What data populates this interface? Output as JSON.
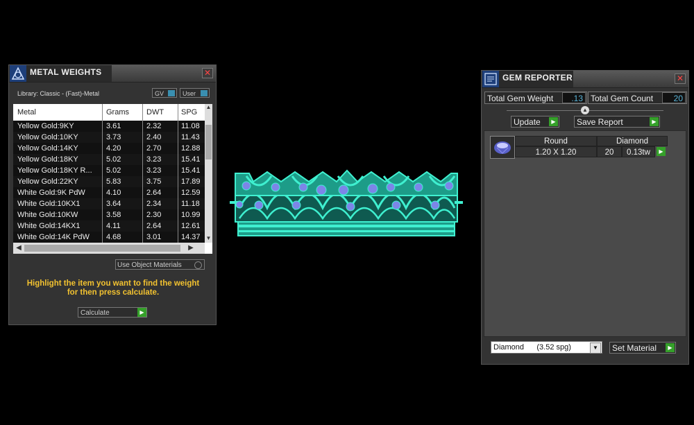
{
  "metal_weights": {
    "title": "METAL WEIGHTS",
    "close_glyph": "✕",
    "library_label": "Library: Classic - (Fast)-Metal",
    "toggle_gv": "GV",
    "toggle_user": "User",
    "columns": [
      "Metal",
      "Grams",
      "DWT",
      "SPG"
    ],
    "rows": [
      [
        "Yellow Gold:9KY",
        "3.61",
        "2.32",
        "11.08"
      ],
      [
        "Yellow Gold:10KY",
        "3.73",
        "2.40",
        "11.43"
      ],
      [
        "Yellow Gold:14KY",
        "4.20",
        "2.70",
        "12.88"
      ],
      [
        "Yellow Gold:18KY",
        "5.02",
        "3.23",
        "15.41"
      ],
      [
        "Yellow Gold:18KY R...",
        "5.02",
        "3.23",
        "15.41"
      ],
      [
        "Yellow Gold:22KY",
        "5.83",
        "3.75",
        "17.89"
      ],
      [
        "White Gold:9K PdW",
        "4.10",
        "2.64",
        "12.59"
      ],
      [
        "White Gold:10KX1",
        "3.64",
        "2.34",
        "11.18"
      ],
      [
        "White Gold:10KW",
        "3.58",
        "2.30",
        "10.99"
      ],
      [
        "White Gold:14KX1",
        "4.11",
        "2.64",
        "12.61"
      ],
      [
        "White Gold:14K PdW",
        "4.68",
        "3.01",
        "14.37"
      ]
    ],
    "use_object_materials": "Use Object Materials",
    "hint_line1": "Highlight the item you want to find the weight",
    "hint_line2": "for then press calculate.",
    "calculate_label": "Calculate"
  },
  "gem_reporter": {
    "title": "GEM REPORTER",
    "close_glyph": "✕",
    "total_weight_label": "Total Gem Weight",
    "total_weight_value": ".13",
    "total_count_label": "Total Gem Count",
    "total_count_value": "20",
    "update_label": "Update",
    "save_report_label": "Save Report",
    "gem_row": {
      "shape": "Round",
      "size": "1.20 X 1.20",
      "material": "Diamond",
      "count": "20",
      "carat": "0.13tw"
    },
    "material_select": "Diamond      (3.52 spg)",
    "set_material_label": "Set Material"
  },
  "colors": {
    "crown": "#3ff0d0",
    "gem_stones": "#7c86e8",
    "hint": "#f2c230",
    "play_button": "#35a02a",
    "value_text": "#5ab4d8"
  }
}
